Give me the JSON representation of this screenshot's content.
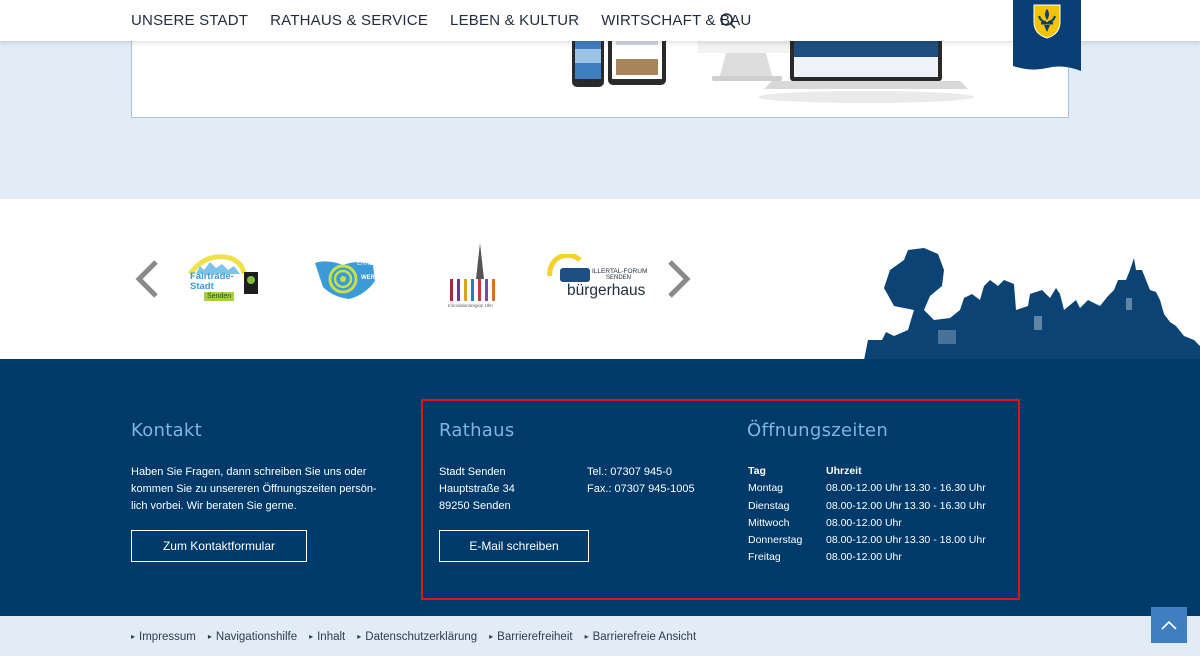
{
  "nav": {
    "items": [
      "UNSERE STADT",
      "RATHAUS & SERVICE",
      "LEBEN & KULTUR",
      "WIRTSCHAFT & BAU"
    ]
  },
  "colors": {
    "navy": "#003a6a",
    "light_blue": "#e1ecf6",
    "accent_title": "#7fb4e6",
    "highlight": "#e3131b"
  },
  "partners": {
    "logos": [
      {
        "name": "fairtrade-logo",
        "text1": "Fairtrade-",
        "text2": "Stadt",
        "text3": "Senden"
      },
      {
        "name": "ehrenwert-logo",
        "text1": "EHREN",
        "text2": "WERT"
      },
      {
        "name": "innovationsregion-logo",
        "text1": "Innovationsregion Ulm"
      },
      {
        "name": "buergerhaus-logo",
        "text1": "ILLERTAL-FORUM",
        "text2": "SENDEN",
        "text3": "bürgerhaus"
      }
    ]
  },
  "contact": {
    "title": "Kontakt",
    "text_lines": [
      "Haben Sie Fragen, dann schreiben Sie uns oder",
      "kommen Sie zu unsereren Öffnungszeiten persön-",
      "lich vorbei. Wir beraten Sie gerne."
    ],
    "button": "Zum Kontaktformular"
  },
  "rathaus": {
    "title": "Rathaus",
    "address": [
      "Stadt Senden",
      "Hauptstraße 34",
      "89250 Senden"
    ],
    "phone": "Tel.: 07307 945-0",
    "fax": "Fax.: 07307 945-1005",
    "button": "E-Mail schreiben"
  },
  "hours": {
    "title": "Öffnungszeiten",
    "col_day": "Tag",
    "col_time": "Uhrzeit",
    "rows": [
      {
        "day": "Montag",
        "t1": "08.00-12.00 Uhr",
        "t2": "13.30 - 16.30 Uhr"
      },
      {
        "day": "Dienstag",
        "t1": "08.00-12.00 Uhr",
        "t2": "13.30 - 16.30 Uhr"
      },
      {
        "day": "Mittwoch",
        "t1": "08.00-12.00 Uhr",
        "t2": ""
      },
      {
        "day": "Donnerstag",
        "t1": "08.00-12.00 Uhr",
        "t2": "13.30 - 18.00 Uhr"
      },
      {
        "day": "Freitag",
        "t1": "08.00-12.00 Uhr",
        "t2": ""
      }
    ]
  },
  "footer_links": [
    "Impressum",
    "Navigationshilfe",
    "Inhalt",
    "Datenschutzerklärung",
    "Barrierefreiheit",
    "Barrierefreie Ansicht"
  ]
}
